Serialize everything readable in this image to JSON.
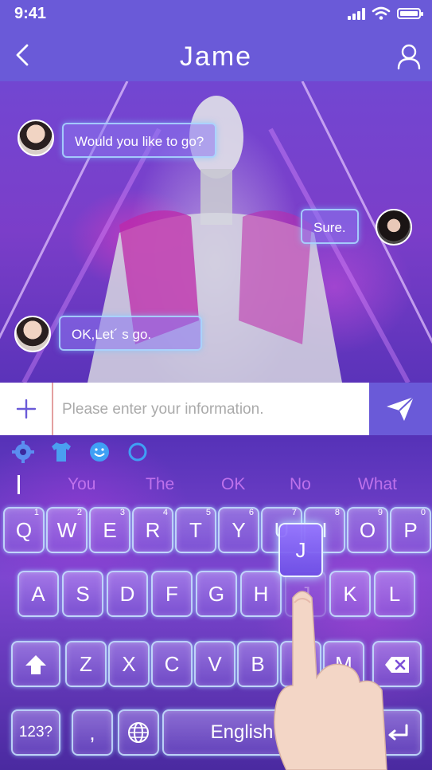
{
  "status_bar": {
    "time": "9:41"
  },
  "header": {
    "back_icon": "chevron-left-icon",
    "title": "Jame",
    "profile_icon": "user-icon"
  },
  "messages": [
    {
      "sender": "other",
      "text": "Would you like to go?"
    },
    {
      "sender": "me",
      "text": "Sure."
    },
    {
      "sender": "other",
      "text": "OK,Let´ s go."
    }
  ],
  "composer": {
    "add_icon": "plus-icon",
    "placeholder": "Please enter your information.",
    "send_icon": "send-icon"
  },
  "keyboard": {
    "toolbar_icons": [
      "gear-icon",
      "shirt-icon",
      "emoji-icon",
      "circle-icon"
    ],
    "suggestions": [
      "You",
      "The",
      "OK",
      "No",
      "What"
    ],
    "row1": [
      {
        "key": "Q",
        "num": "1"
      },
      {
        "key": "W",
        "num": "2"
      },
      {
        "key": "E",
        "num": "3"
      },
      {
        "key": "R",
        "num": "4"
      },
      {
        "key": "T",
        "num": "5"
      },
      {
        "key": "Y",
        "num": "6"
      },
      {
        "key": "U",
        "num": "7"
      },
      {
        "key": "I",
        "num": "8"
      },
      {
        "key": "O",
        "num": "9"
      },
      {
        "key": "P",
        "num": "0"
      }
    ],
    "row2": [
      "A",
      "S",
      "D",
      "F",
      "G",
      "H",
      "J",
      "K",
      "L"
    ],
    "row3": [
      "Z",
      "X",
      "C",
      "V",
      "B",
      "N",
      "M"
    ],
    "pressed_key": "J",
    "mode_key": "123?",
    "comma_key": ",",
    "language": "English",
    "accent": "#6a5ad8"
  }
}
